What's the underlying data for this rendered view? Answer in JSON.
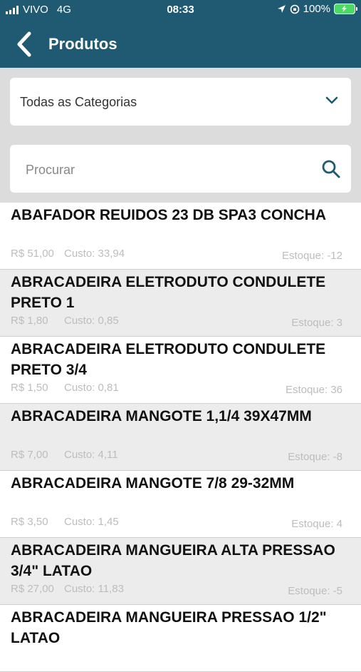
{
  "status_bar": {
    "carrier": "VIVO",
    "network": "4G",
    "time": "08:33",
    "battery": "100%"
  },
  "navbar": {
    "title": "Produtos"
  },
  "category_select": {
    "value": "Todas as Categorias"
  },
  "search": {
    "placeholder": "Procurar"
  },
  "products": [
    {
      "name": "ABAFADOR REUIDOS 23 DB SPA3 CONCHA",
      "price": "R$ 51,00",
      "cost": "Custo: 33,94",
      "stock": "Estoque: -12"
    },
    {
      "name": "ABRACADEIRA ELETRODUTO CONDULETE PRETO 1",
      "price": "R$ 1,80",
      "cost": "Custo: 0,85",
      "stock": "Estoque: 3"
    },
    {
      "name": "ABRACADEIRA ELETRODUTO CONDULETE PRETO 3/4",
      "price": "R$ 1,50",
      "cost": "Custo: 0,81",
      "stock": "Estoque: 36"
    },
    {
      "name": "ABRACADEIRA MANGOTE 1,1/4 39X47MM",
      "price": "R$ 7,00",
      "cost": "Custo: 4,11",
      "stock": "Estoque: -8"
    },
    {
      "name": "ABRACADEIRA MANGOTE 7/8 29-32MM",
      "price": "R$ 3,50",
      "cost": "Custo: 1,45",
      "stock": "Estoque: 4"
    },
    {
      "name": "ABRACADEIRA MANGUEIRA ALTA PRESSAO 3/4\" LATAO",
      "price": "R$ 27,00",
      "cost": "Custo: 11,83",
      "stock": "Estoque: -5"
    },
    {
      "name": "ABRACADEIRA MANGUEIRA PRESSAO 1/2\" LATAO",
      "price": "",
      "cost": "",
      "stock": ""
    }
  ]
}
